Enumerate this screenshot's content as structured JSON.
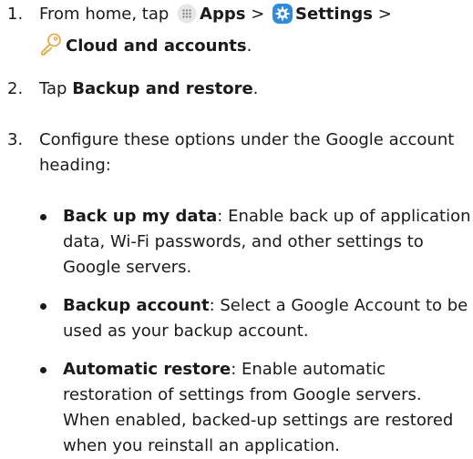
{
  "steps": [
    {
      "number": "1.",
      "prefix": "From home, tap",
      "apps_label": "Apps",
      "sep1": ">",
      "settings_label": "Settings",
      "sep2": ">",
      "cloud_label": "Cloud and accounts",
      "end": "."
    },
    {
      "number": "2.",
      "prefix": "Tap",
      "bold": "Backup and restore",
      "end": "."
    },
    {
      "number": "3.",
      "line1": "Configure these options under the Google account",
      "line2": "heading:"
    }
  ],
  "bullets": [
    {
      "title": "Back up my data",
      "lines": [
        ": Enable back up of application",
        "data, Wi-Fi passwords, and other settings to",
        "Google servers."
      ]
    },
    {
      "title": "Backup account",
      "lines": [
        ": Select a Google Account to be",
        "used as your backup account."
      ]
    },
    {
      "title": "Automatic restore",
      "lines": [
        ": Enable automatic",
        "restoration of settings from Google servers.",
        "When enabled, backed-up settings are restored",
        "when you reinstall an application."
      ]
    }
  ],
  "icons": {
    "apps": "apps-grid-icon",
    "settings": "settings-gear-icon",
    "cloud": "key-icon"
  },
  "colors": {
    "text": "#1a1a1a",
    "settings_blue": "#2d8be0",
    "key_orange": "#f0a030",
    "apps_gray": "#dcdcdc"
  }
}
